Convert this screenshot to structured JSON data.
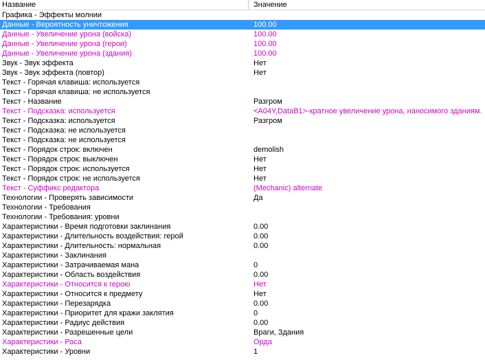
{
  "header": {
    "name": "Название",
    "value": "Значение"
  },
  "colors": {
    "modified": "#cc00cc",
    "selection": "#3399ff"
  },
  "rows": [
    {
      "name": "Графика - Эффекты молнии",
      "value": "",
      "state": ""
    },
    {
      "name": "Данные - Вероятность уничтожения",
      "value": "100.00",
      "state": "sel"
    },
    {
      "name": "Данные - Увеличение урона (войска)",
      "value": "100.00",
      "state": "mod"
    },
    {
      "name": "Данные - Увеличение урона (герои)",
      "value": "100.00",
      "state": "mod"
    },
    {
      "name": "Данные - Увеличение урона (здания)",
      "value": "100.00",
      "state": "mod"
    },
    {
      "name": "Звук - Звук эффекта",
      "value": "Нет",
      "state": ""
    },
    {
      "name": "Звук - Звук эффекта (повтор)",
      "value": "Нет",
      "state": ""
    },
    {
      "name": "Текст - Горячая клавиша: используется",
      "value": "",
      "state": ""
    },
    {
      "name": "Текст - Горячая клавиша: не используется",
      "value": "",
      "state": ""
    },
    {
      "name": "Текст - Название",
      "value": "Разгром",
      "state": ""
    },
    {
      "name": "Текст - Подсказка: используется",
      "value": "<A04Y,DataB1>-кратное увеличение урона, наносимого зданиям.",
      "state": "mod"
    },
    {
      "name": "Текст - Подсказка: используется",
      "value": "Разгром",
      "state": ""
    },
    {
      "name": "Текст - Подсказка: не используется",
      "value": "",
      "state": ""
    },
    {
      "name": "Текст - Подсказка: не используется",
      "value": "",
      "state": ""
    },
    {
      "name": "Текст - Порядок строк: включен",
      "value": "demolish",
      "state": ""
    },
    {
      "name": "Текст - Порядок строк: выключен",
      "value": "Нет",
      "state": ""
    },
    {
      "name": "Текст - Порядок строк: используется",
      "value": "Нет",
      "state": ""
    },
    {
      "name": "Текст - Порядок строк: не используется",
      "value": "Нет",
      "state": ""
    },
    {
      "name": "Текст - Суффикс редактора",
      "value": "(Mechanic) alternate",
      "state": "mod"
    },
    {
      "name": "Технологии - Проверять зависимости",
      "value": "Да",
      "state": ""
    },
    {
      "name": "Технологии - Требования",
      "value": "",
      "state": ""
    },
    {
      "name": "Технологии - Требования: уровни",
      "value": "",
      "state": ""
    },
    {
      "name": "Характеристики - Время подготовки заклинания",
      "value": "0.00",
      "state": ""
    },
    {
      "name": "Характеристики - Длительность воздействия: герой",
      "value": "0.00",
      "state": ""
    },
    {
      "name": "Характеристики - Длительность: нормальная",
      "value": "0.00",
      "state": ""
    },
    {
      "name": "Характеристики - Заклинания",
      "value": "",
      "state": ""
    },
    {
      "name": "Характеристики - Затрачиваемая мана",
      "value": "0",
      "state": ""
    },
    {
      "name": "Характеристики - Область воздействия",
      "value": "0.00",
      "state": ""
    },
    {
      "name": "Характеристики - Относится к герою",
      "value": "Нет",
      "state": "mod"
    },
    {
      "name": "Характеристики - Относится к предмету",
      "value": "Нет",
      "state": ""
    },
    {
      "name": "Характеристики - Перезарядка",
      "value": "0.00",
      "state": ""
    },
    {
      "name": "Характеристики - Приоритет для кражи заклятия",
      "value": "0",
      "state": ""
    },
    {
      "name": "Характеристики - Радиус действия",
      "value": "0.00",
      "state": ""
    },
    {
      "name": "Характеристики - Разрешенные цели",
      "value": "Враги, Здания",
      "state": ""
    },
    {
      "name": "Характеристики - Раса",
      "value": "Орда",
      "state": "mod"
    },
    {
      "name": "Характеристики - Уровни",
      "value": "1",
      "state": ""
    }
  ]
}
